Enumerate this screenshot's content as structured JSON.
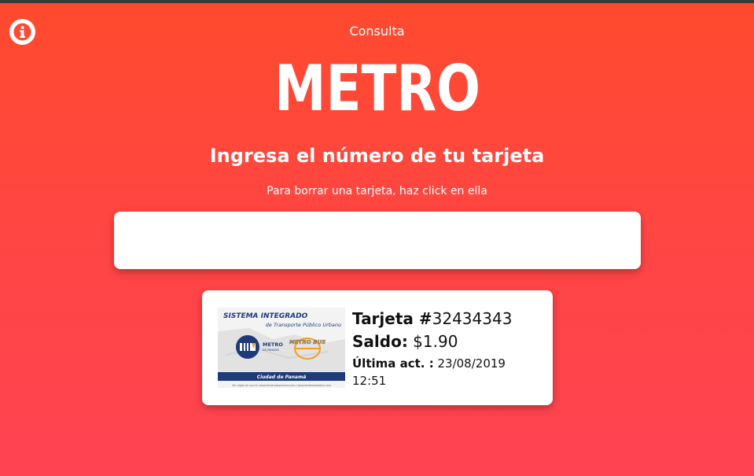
{
  "header": {
    "subtitle": "Consulta",
    "logo_text": "METRO",
    "title": "Ingresa el número de tu tarjeta",
    "hint": "Para borrar una tarjeta, haz click en ella"
  },
  "search": {
    "value": "",
    "placeholder": ""
  },
  "cards": [
    {
      "number_label": "Tarjeta #",
      "number": "32434343",
      "balance_label": "Saldo:",
      "balance": "$1.90",
      "updated_label": "Última act. :",
      "updated": "23/08/2019 12:51",
      "image": {
        "title": "SISTEMA INTEGRADO",
        "subtitle": "de Transporte Público Urbano",
        "metro_logo": "METRO",
        "metro_sub": "DE PANAMÁ",
        "bus_logo": "METRO BUS",
        "city": "Ciudad de Panamá",
        "footer": "Ver reglas de uso en: www.elmetrodepanama.com / www.tarjetametrobus.com"
      }
    }
  ],
  "icons": {
    "info": "info-icon"
  },
  "colors": {
    "background_top": "#ff4a2e",
    "background_bottom": "#ff4352",
    "card_blue": "#1e3a7a",
    "bus_orange": "#f0a020"
  }
}
